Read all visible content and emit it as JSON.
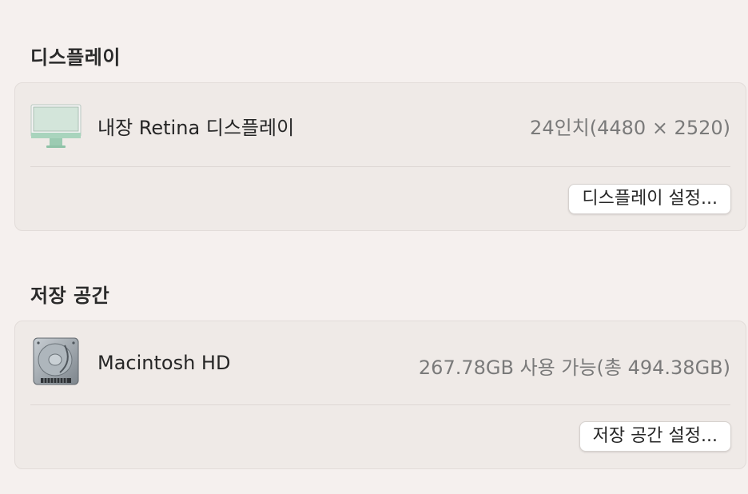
{
  "display": {
    "section_title": "디스플레이",
    "item_name": "내장 Retina 디스플레이",
    "item_value": "24인치(4480 × 2520)",
    "icon": "imac-icon",
    "settings_button": "디스플레이 설정..."
  },
  "storage": {
    "section_title": "저장 공간",
    "item_name": "Macintosh HD",
    "item_value": "267.78GB 사용 가능(총 494.38GB)",
    "icon": "hard-drive-icon",
    "settings_button": "저장 공간 설정..."
  },
  "colors": {
    "background": "#f5f0ee",
    "card": "#efeae7",
    "imac_screen": "#cfe3d8",
    "imac_stand": "#8fc7aa"
  }
}
